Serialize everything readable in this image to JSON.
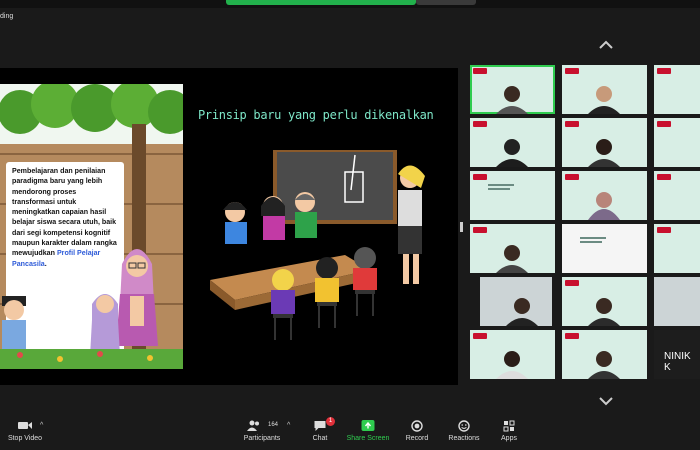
{
  "top_bar": {
    "recording_label": "ding"
  },
  "slide": {
    "title": "Prinsip baru yang perlu dikenalkan",
    "body_text": "Pembelajaran dan penilaian paradigma baru yang lebih mendorong proses transformasi untuk meningkatkan capaian hasil belajar siswa secara utuh, baik dari segi kompetensi kognitif maupun karakter dalam rangka mewujudkan",
    "highlight_text": "Profil Pelajar Pancasila",
    "end_punct": "."
  },
  "gallery": {
    "partial_name": "NINIK K",
    "tiles": 18
  },
  "toolbar": {
    "stop_video": "Stop Video",
    "participants": "Participants",
    "participants_count": "164",
    "chat": "Chat",
    "chat_badge": "1",
    "share_screen": "Share Screen",
    "record": "Record",
    "reactions": "Reactions",
    "apps": "Apps"
  },
  "colors": {
    "share_green": "#2fcc4f",
    "slide_title": "#7ee7c8",
    "highlight_blue": "#2e5bd8"
  }
}
